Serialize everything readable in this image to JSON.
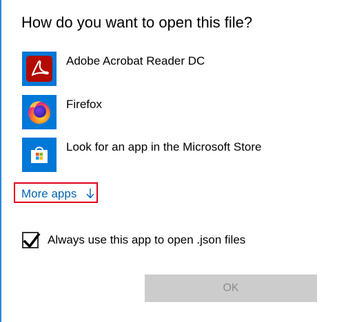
{
  "dialog": {
    "title": "How do you want to open this file?",
    "apps": [
      {
        "label": "Adobe Acrobat Reader DC",
        "icon": "adobe-acrobat-icon"
      },
      {
        "label": "Firefox",
        "icon": "firefox-icon"
      },
      {
        "label": "Look for an app in the Microsoft Store",
        "icon": "microsoft-store-icon"
      }
    ],
    "more_apps": {
      "label": "More apps",
      "icon": "arrow-down-icon"
    },
    "always_use": {
      "label": "Always use this app to open .json files",
      "checked": true
    },
    "ok_button": {
      "label": "OK",
      "enabled": false
    }
  },
  "colors": {
    "accent": "#0078d7",
    "link": "#0063b1",
    "highlight_border": "#e0001b",
    "disabled_button_bg": "#cccccc",
    "disabled_button_text": "#8c8c8c"
  }
}
